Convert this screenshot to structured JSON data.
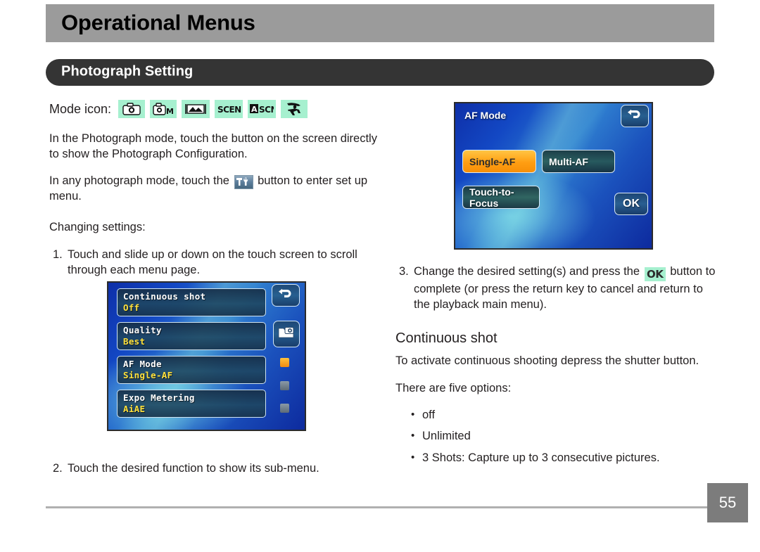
{
  "header": {
    "title": "Operational Menus",
    "section_title": "Photograph Setting"
  },
  "mode": {
    "label": "Mode icon:",
    "icons": [
      {
        "name": "camera-auto-icon",
        "alt": "camera"
      },
      {
        "name": "camera-manual-icon",
        "alt": "camera M"
      },
      {
        "name": "panorama-icon",
        "alt": "panorama"
      },
      {
        "name": "scene-icon",
        "alt": "SCENE"
      },
      {
        "name": "auto-scene-icon",
        "alt": "A SCN"
      },
      {
        "name": "sports-figure-icon",
        "alt": "action figure"
      }
    ]
  },
  "left_column": {
    "intro_paragraph": "In the Photograph mode, touch the button on the screen directly to show the Photograph Configuration.",
    "setup_paragraph_before": "In any photograph mode, touch the",
    "setup_icon_name": "tools-setup-icon",
    "setup_paragraph_after": "button to enter set up menu.",
    "changing_settings_label": "Changing settings:",
    "steps": [
      {
        "num": "1.",
        "text": "Touch and slide up or down on the touch screen to scroll through each menu page."
      },
      {
        "num": "2.",
        "text": "Touch the desired function to show its sub-menu."
      }
    ]
  },
  "menu_screen": {
    "rows": [
      {
        "label": "Continuous shot",
        "value": "Off"
      },
      {
        "label": "Quality",
        "value": "Best"
      },
      {
        "label": "AF Mode",
        "value": "Single-AF"
      },
      {
        "label": "Expo Metering",
        "value": "AiAE"
      }
    ],
    "buttons": [
      {
        "name": "return-button",
        "icon": "back-arrow-icon"
      },
      {
        "name": "playback-button",
        "icon": "folder-camera-icon"
      }
    ],
    "page_indicators": [
      {
        "state": "active"
      },
      {
        "state": "inactive"
      },
      {
        "state": "inactive"
      }
    ],
    "accent_active": "#f5a01a"
  },
  "af_screen": {
    "title": "AF Mode",
    "options": [
      {
        "label": "Single-AF",
        "selected": true
      },
      {
        "label": "Multi-AF",
        "selected": false
      },
      {
        "label": "Touch-to-Focus",
        "selected": false
      }
    ],
    "ok_label": "OK",
    "return_icon": "back-arrow-icon",
    "selected_color": "#ff9e12"
  },
  "right_column": {
    "step3": {
      "num": "3.",
      "text_before": "Change the desired setting(s) and press the",
      "icon_label": "OK",
      "icon_name": "ok-button-icon",
      "text_after": "button to complete (or press the return key to cancel and return to the playback main menu)."
    },
    "subhead": "Continuous shot",
    "description": "To activate continuous shooting depress the shutter button.",
    "options_intro": "There are five options:",
    "bullets": [
      "off",
      "Unlimited",
      "3 Shots: Capture up to 3 consecutive pictures."
    ]
  },
  "footer": {
    "page_number": "55"
  }
}
